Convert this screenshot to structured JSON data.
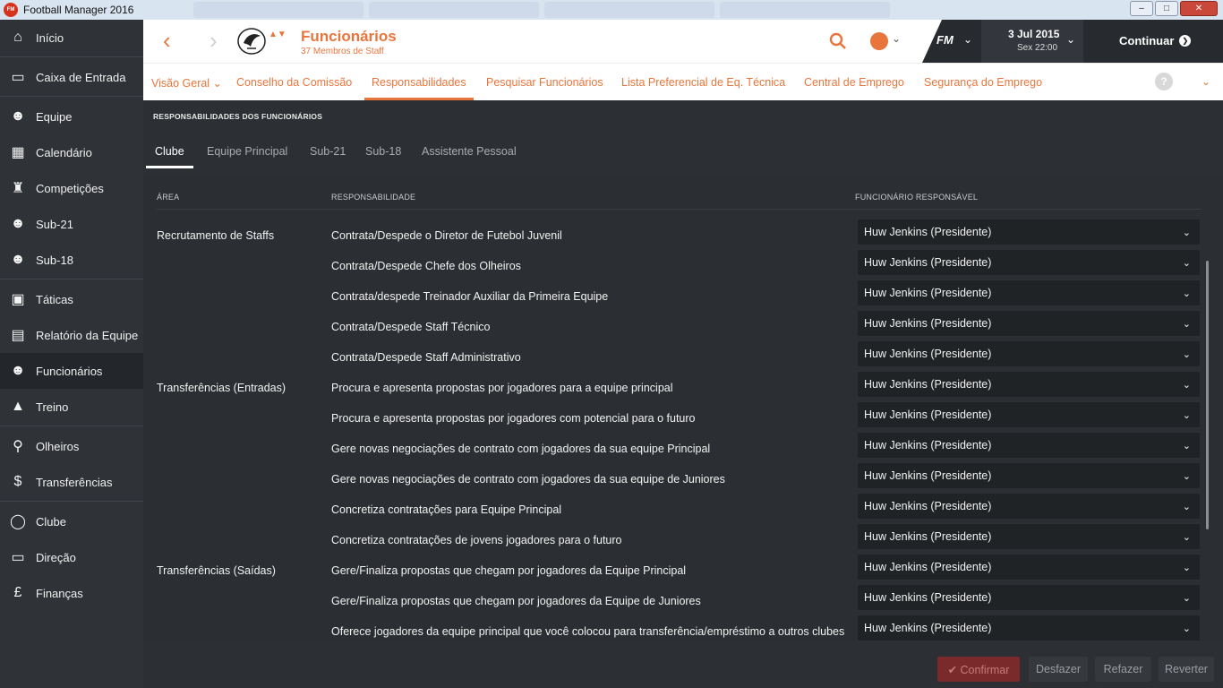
{
  "window": {
    "title": "Football Manager 2016",
    "logo_text": "FM",
    "controls": {
      "minimize": "–",
      "maximize": "□",
      "close": "✕"
    }
  },
  "sidebar": {
    "items": [
      {
        "label": "Início",
        "icon": "home-icon",
        "glyph": "⌂"
      },
      {
        "label": "Caixa de Entrada",
        "icon": "inbox-icon",
        "glyph": "▭"
      },
      {
        "label": "Equipe",
        "icon": "team-icon",
        "glyph": "☻"
      },
      {
        "label": "Calendário",
        "icon": "calendar-icon",
        "glyph": "▦"
      },
      {
        "label": "Competições",
        "icon": "trophy-icon",
        "glyph": "♜"
      },
      {
        "label": "Sub-21",
        "icon": "u21-icon",
        "glyph": "☻"
      },
      {
        "label": "Sub-18",
        "icon": "u18-icon",
        "glyph": "☻"
      },
      {
        "label": "Táticas",
        "icon": "tactics-icon",
        "glyph": "▣"
      },
      {
        "label": "Relatório da Equipe",
        "icon": "report-icon",
        "glyph": "▤"
      },
      {
        "label": "Funcionários",
        "icon": "staff-icon",
        "glyph": "☻"
      },
      {
        "label": "Treino",
        "icon": "training-icon",
        "glyph": "▲"
      },
      {
        "label": "Olheiros",
        "icon": "scouting-icon",
        "glyph": "⚲"
      },
      {
        "label": "Transferências",
        "icon": "transfers-icon",
        "glyph": "$"
      },
      {
        "label": "Clube",
        "icon": "club-icon",
        "glyph": "◯"
      },
      {
        "label": "Direção",
        "icon": "board-icon",
        "glyph": "▭"
      },
      {
        "label": "Finanças",
        "icon": "finances-icon",
        "glyph": "£"
      }
    ]
  },
  "header": {
    "back": "‹",
    "forward": "›",
    "crest_arrows": "▲▼",
    "title": "Funcionários",
    "subtitle": "37 Membros de Staff",
    "fm_badge": "FM",
    "date": "3 Jul 2015",
    "time": "Sex 22:00",
    "continue": "Continuar",
    "continue_glyph": "❯",
    "chevron": "⌄"
  },
  "tabs": [
    {
      "label": "Visão Geral ⌄"
    },
    {
      "label": "Conselho da Comissão"
    },
    {
      "label": "Responsabilidades"
    },
    {
      "label": "Pesquisar Funcionários"
    },
    {
      "label": "Lista Preferencial de Eq. Técnica"
    },
    {
      "label": "Central de Emprego"
    },
    {
      "label": "Segurança do Emprego"
    }
  ],
  "help": "?",
  "section_title": "RESPONSABILIDADES DOS FUNCIONÁRIOS",
  "subtabs": [
    {
      "label": "Clube"
    },
    {
      "label": "Equipe Principal"
    },
    {
      "label": "Sub-21"
    },
    {
      "label": "Sub-18"
    },
    {
      "label": "Assistente Pessoal"
    }
  ],
  "table": {
    "headers": {
      "area": "ÁREA",
      "resp": "RESPONSABILIDADE",
      "staff": "FUNCIONÁRIO RESPONSÁVEL"
    },
    "rows": [
      {
        "area": "Recrutamento de Staffs",
        "resp": "Contrata/Despede o Diretor de Futebol Juvenil",
        "staff": "Huw Jenkins (Presidente)"
      },
      {
        "area": "",
        "resp": "Contrata/Despede Chefe dos Olheiros",
        "staff": "Huw Jenkins (Presidente)"
      },
      {
        "area": "",
        "resp": "Contrata/despede Treinador Auxiliar da Primeira Equipe",
        "staff": "Huw Jenkins (Presidente)"
      },
      {
        "area": "",
        "resp": "Contrata/Despede Staff Técnico",
        "staff": "Huw Jenkins (Presidente)"
      },
      {
        "area": "",
        "resp": "Contrata/Despede Staff Administrativo",
        "staff": "Huw Jenkins (Presidente)"
      },
      {
        "area": "Transferências (Entradas)",
        "resp": "Procura e apresenta propostas por jogadores para a equipe principal",
        "staff": "Huw Jenkins (Presidente)"
      },
      {
        "area": "",
        "resp": "Procura e apresenta propostas por jogadores com potencial para o futuro",
        "staff": "Huw Jenkins (Presidente)"
      },
      {
        "area": "",
        "resp": "Gere novas negociações de contrato com jogadores da sua equipe Principal",
        "staff": "Huw Jenkins (Presidente)"
      },
      {
        "area": "",
        "resp": "Gere novas negociações de contrato com jogadores da sua equipe de Juniores",
        "staff": "Huw Jenkins (Presidente)"
      },
      {
        "area": "",
        "resp": "Concretiza contratações para Equipe Principal",
        "staff": "Huw Jenkins (Presidente)"
      },
      {
        "area": "",
        "resp": "Concretiza contratações de jovens jogadores para o futuro",
        "staff": "Huw Jenkins (Presidente)"
      },
      {
        "area": "Transferências (Saídas)",
        "resp": "Gere/Finaliza propostas que chegam por jogadores da Equipe Principal",
        "staff": "Huw Jenkins (Presidente)"
      },
      {
        "area": "",
        "resp": "Gere/Finaliza propostas que chegam por jogadores da Equipe de Juniores",
        "staff": "Huw Jenkins (Presidente)"
      },
      {
        "area": "",
        "resp": "Oferece jogadores da equipe principal que você colocou para transferência/empréstimo a outros clubes",
        "staff": "Huw Jenkins (Presidente)"
      }
    ]
  },
  "footer": {
    "confirm": "✔ Confirmar",
    "undo": "Desfazer",
    "redo": "Refazer",
    "revert": "Reverter"
  },
  "colors": {
    "accent": "#e8763c",
    "sidebar_bg": "#2f3237",
    "content_bg": "#2c2f33",
    "select_bg": "#202326"
  }
}
